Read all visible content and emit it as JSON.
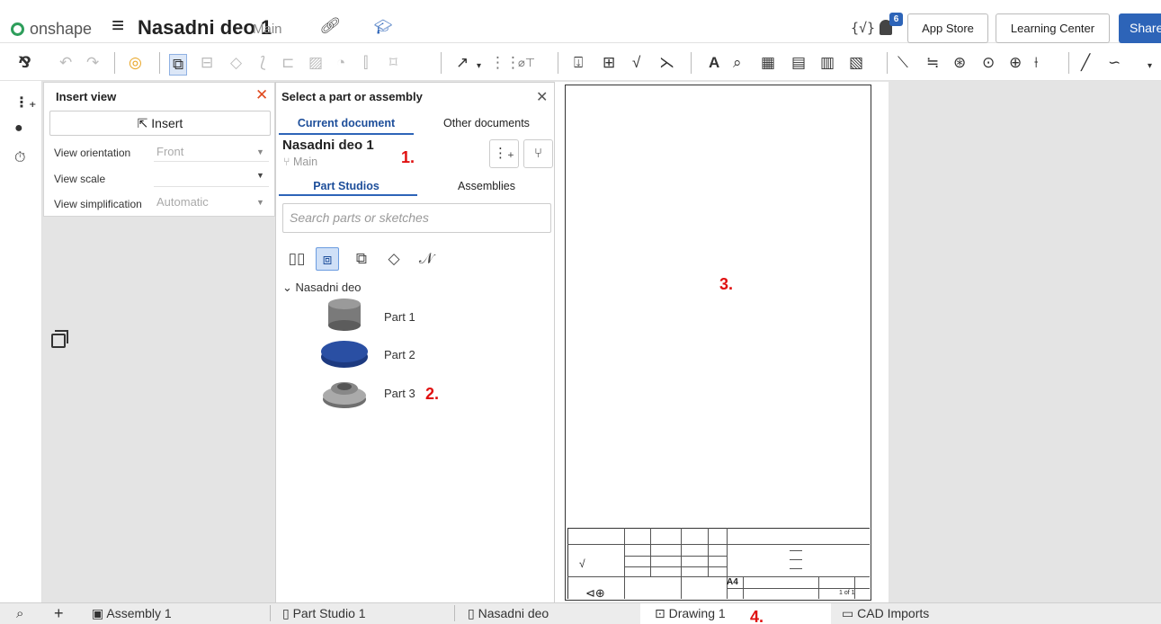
{
  "header": {
    "logo_text": "onshape",
    "doc_title": "Nasadni deo 1",
    "doc_branch": "Main",
    "notifications_count": "6",
    "app_store": "App Store",
    "learning_center": "Learning Center",
    "share": "Share"
  },
  "insert_view": {
    "title": "Insert view",
    "insert_label": "Insert",
    "rows": [
      {
        "label": "View orientation",
        "value": "Front"
      },
      {
        "label": "View scale",
        "value": ""
      },
      {
        "label": "View simplification",
        "value": "Automatic"
      }
    ]
  },
  "select_panel": {
    "title": "Select a part or assembly",
    "tabs": [
      "Current document",
      "Other documents"
    ],
    "doc_name": "Nasadni deo 1",
    "doc_branch": "Main",
    "subtabs": [
      "Part Studios",
      "Assemblies"
    ],
    "search_placeholder": "Search parts or sketches",
    "tree_group": "Nasadni deo",
    "parts": [
      "Part 1",
      "Part 2",
      "Part 3"
    ]
  },
  "markers": [
    "1.",
    "2.",
    "3.",
    "4."
  ],
  "title_block": {
    "size": "A4",
    "sheet": "1 of 1"
  },
  "bottom_tabs": [
    {
      "label": "Assembly 1"
    },
    {
      "label": "Part Studio 1"
    },
    {
      "label": "Nasadni deo"
    },
    {
      "label": "Drawing 1"
    },
    {
      "label": "CAD Imports"
    }
  ],
  "colors": {
    "accent": "#2d64b8",
    "close_red": "#e04a1f",
    "marker_red": "#e01010",
    "part2_blue": "#2a4fa3"
  }
}
